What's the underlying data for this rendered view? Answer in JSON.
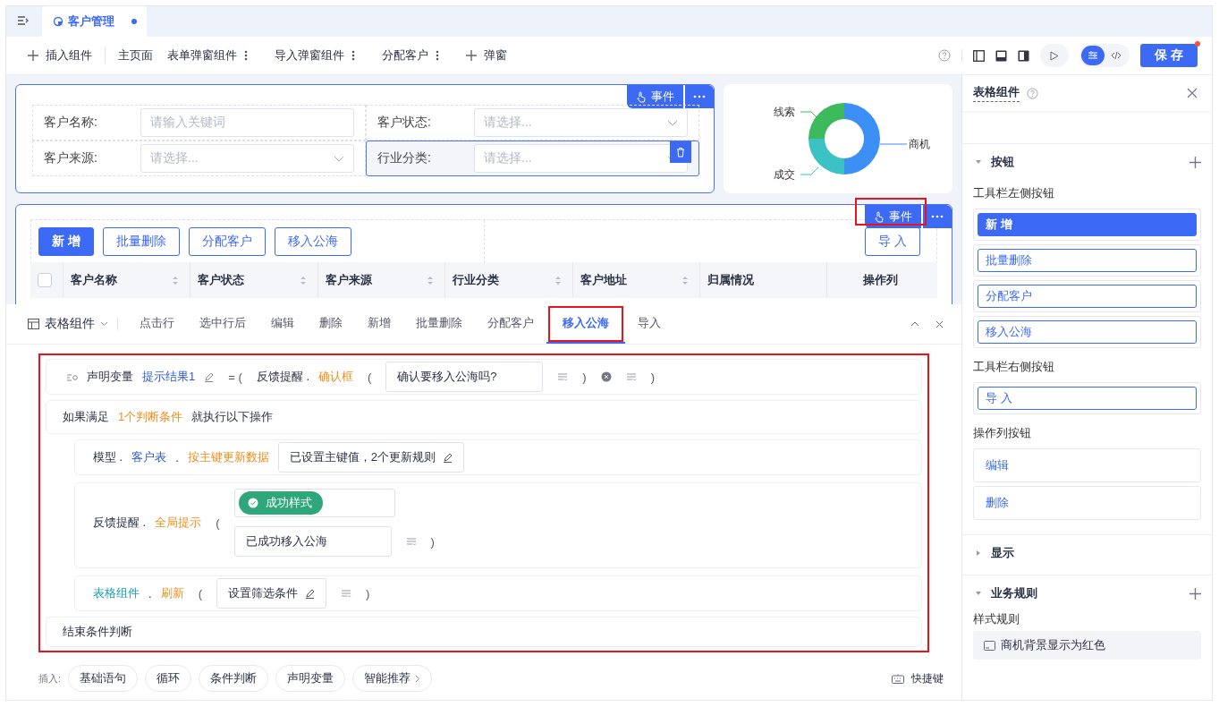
{
  "tab": {
    "label": "客户管理",
    "unsaved": true
  },
  "toolbar": {
    "items": [
      {
        "kind": "add",
        "label": "插入组件"
      },
      {
        "kind": "page",
        "label": "主页面"
      },
      {
        "kind": "menu",
        "label": "表单弹窗组件"
      },
      {
        "kind": "menu",
        "label": "导入弹窗组件"
      },
      {
        "kind": "menu",
        "label": "分配客户"
      },
      {
        "kind": "add",
        "label": "弹窗"
      }
    ],
    "view_modes": [
      {
        "kind": "design",
        "selected": true
      },
      {
        "kind": "code",
        "selected": false
      }
    ],
    "save": "保 存",
    "save_dot": true
  },
  "form": {
    "event_button": {
      "label": "事件",
      "highlighted": false
    },
    "fields": [
      {
        "label": "客户名称:",
        "placeholder": "请输入关键词",
        "dropdown": false,
        "selected": false
      },
      {
        "label": "客户状态:",
        "placeholder": "请选择...",
        "dropdown": true,
        "selected": false
      },
      {
        "label": "客户来源:",
        "placeholder": "请选择...",
        "dropdown": true,
        "selected": false
      },
      {
        "label": "行业分类:",
        "placeholder": "请选择...",
        "dropdown": true,
        "selected": true
      }
    ]
  },
  "chart": {
    "labels": [
      {
        "label": "线索",
        "color": "#3cba5c"
      },
      {
        "label": "商机",
        "color": "#3b8ff5"
      },
      {
        "label": "成交",
        "color": "#3cc1c4"
      }
    ]
  },
  "table": {
    "event_button": {
      "label": "事件",
      "highlighted": true
    },
    "left_buttons": [
      {
        "label": "新 增",
        "primary": true
      },
      {
        "label": "批量删除",
        "primary": false
      },
      {
        "label": "分配客户",
        "primary": false
      },
      {
        "label": "移入公海",
        "primary": false
      }
    ],
    "right_buttons": [
      {
        "label": "导 入",
        "primary": false
      }
    ],
    "select_all": {
      "checked": false
    },
    "columns": [
      {
        "label": "客户名称",
        "sortable": true
      },
      {
        "label": "客户状态",
        "sortable": true
      },
      {
        "label": "客户来源",
        "sortable": true
      },
      {
        "label": "行业分类",
        "sortable": true
      },
      {
        "label": "客户地址",
        "sortable": true
      },
      {
        "label": "归属情况",
        "sortable": false
      },
      {
        "label": "操作列",
        "sortable": false
      }
    ]
  },
  "events": {
    "component": "表格组件",
    "tabs": [
      {
        "label": "点击行",
        "selected": false,
        "highlighted": false
      },
      {
        "label": "选中行后",
        "selected": false,
        "highlighted": false
      },
      {
        "label": "编辑",
        "selected": false,
        "highlighted": false
      },
      {
        "label": "删除",
        "selected": false,
        "highlighted": false
      },
      {
        "label": "新增",
        "selected": false,
        "highlighted": false
      },
      {
        "label": "批量删除",
        "selected": false,
        "highlighted": false
      },
      {
        "label": "分配客户",
        "selected": false,
        "highlighted": false
      },
      {
        "label": "移入公海",
        "selected": true,
        "highlighted": true
      },
      {
        "label": "导入",
        "selected": false,
        "highlighted": false
      }
    ],
    "code_highlighted": true,
    "declare": [
      {
        "kind": "var-icon"
      },
      {
        "kind": "text",
        "text": "声明变量"
      },
      {
        "kind": "variable",
        "text": "提示结果1"
      },
      {
        "kind": "edit"
      },
      {
        "kind": "punct",
        "text": "= ("
      },
      {
        "kind": "text",
        "text": "反馈提醒 ."
      },
      {
        "kind": "method",
        "text": "确认框"
      },
      {
        "kind": "punct",
        "text": "("
      },
      {
        "kind": "field",
        "text": "确认要移入公海吗?"
      },
      {
        "kind": "options"
      },
      {
        "kind": "punct",
        "text": ")"
      },
      {
        "kind": "clear"
      },
      {
        "kind": "options"
      },
      {
        "kind": "punct",
        "text": ")"
      }
    ],
    "condition": [
      {
        "kind": "text",
        "text": "如果满足"
      },
      {
        "kind": "method",
        "text": "1个判断条件"
      },
      {
        "kind": "text",
        "text": "就执行以下操作"
      }
    ],
    "actions": [
      {
        "kind": "model",
        "tokens": [
          {
            "kind": "text",
            "text": "模型 ."
          },
          {
            "kind": "object",
            "text": "客户表"
          },
          {
            "kind": "text",
            "text": "."
          },
          {
            "kind": "method",
            "text": "按主键更新数据"
          },
          {
            "kind": "edit-field",
            "text": "已设置主键值，2个更新规则"
          }
        ]
      },
      {
        "kind": "toast",
        "tokens": [
          {
            "kind": "text",
            "text": "反馈提醒 ."
          },
          {
            "kind": "method",
            "text": "全局提示"
          },
          {
            "kind": "punct",
            "text": "("
          },
          {
            "kind": "stack",
            "rows": [
              [
                {
                  "kind": "tag-field",
                  "text": "成功样式"
                }
              ],
              [
                {
                  "kind": "field",
                  "text": "已成功移入公海"
                },
                {
                  "kind": "options"
                },
                {
                  "kind": "punct",
                  "text": ")"
                }
              ]
            ]
          }
        ]
      },
      {
        "kind": "refresh",
        "tokens": [
          {
            "kind": "component",
            "text": "表格组件"
          },
          {
            "kind": "text",
            "text": "."
          },
          {
            "kind": "method",
            "text": "刷新"
          },
          {
            "kind": "punct",
            "text": "("
          },
          {
            "kind": "edit-field",
            "text": "设置筛选条件"
          },
          {
            "kind": "options"
          },
          {
            "kind": "punct",
            "text": ")"
          }
        ]
      }
    ],
    "end": "结束条件判断",
    "insert_label": "插入:",
    "insert_buttons": [
      "基础语句",
      "循环",
      "条件判断",
      "声明变量",
      "智能推荐"
    ],
    "shortcut": "快捷键"
  },
  "panel": {
    "title": "表格组件",
    "buttons_section": {
      "title": "按钮",
      "expanded": true,
      "groups": [
        {
          "title": "工具栏左侧按钮",
          "items": [
            {
              "label": "新 增",
              "primary": true
            },
            {
              "label": "批量删除",
              "primary": false
            },
            {
              "label": "分配客户",
              "primary": false
            },
            {
              "label": "移入公海",
              "primary": false
            }
          ]
        },
        {
          "title": "工具栏右侧按钮",
          "items": [
            {
              "label": "导 入",
              "primary": false
            }
          ]
        },
        {
          "title": "操作列按钮",
          "items": [
            {
              "label": "编辑",
              "plain": true
            },
            {
              "label": "删除",
              "plain": true
            }
          ]
        }
      ]
    },
    "display_section": {
      "title": "显示",
      "expanded": false
    },
    "rules_section": {
      "title": "业务规则",
      "expanded": true,
      "subtitle": "样式规则",
      "rule": "商机背景显示为红色"
    }
  }
}
